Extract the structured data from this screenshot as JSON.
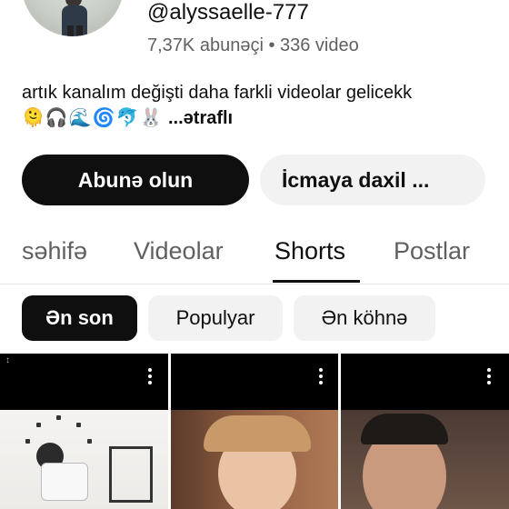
{
  "channel": {
    "handle": "@alyssaelle-777",
    "stats": "7,37K abunəçi • 336 video",
    "description_text": "artık kanalım değişti daha farkli videolar gelicekk",
    "description_emojis": "🫠🎧🌊🌀🐬🐰",
    "description_more": "...ətraflı"
  },
  "buttons": {
    "subscribe": "Abunə olun",
    "join": "İcmaya daxil ..."
  },
  "tabs": [
    {
      "label": "səhifə",
      "active": false
    },
    {
      "label": "Videolar",
      "active": false
    },
    {
      "label": "Shorts",
      "active": true
    },
    {
      "label": "Postlar",
      "active": false
    }
  ],
  "filters": [
    {
      "label": "Ən son",
      "selected": true
    },
    {
      "label": "Populyar",
      "selected": false
    },
    {
      "label": "Ən köhnə",
      "selected": false
    }
  ],
  "shorts": [
    {
      "icon": "more-vert-icon"
    },
    {
      "icon": "more-vert-icon"
    },
    {
      "icon": "more-vert-icon"
    }
  ],
  "colors": {
    "primary_text": "#0f0f0f",
    "secondary_text": "#606060",
    "chip_background": "#f2f2f2"
  }
}
